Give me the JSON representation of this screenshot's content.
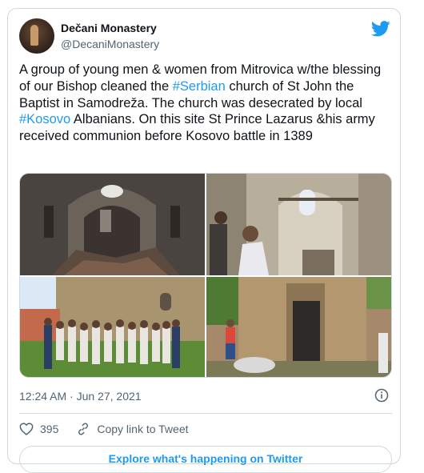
{
  "tweet": {
    "author_name": "Dečani Monastery",
    "author_handle": "@DecaniMonastery",
    "text_parts": [
      "A group of young men & women from Mitrovica w/the blessing of our Bishop cleaned the ",
      "#Serbian",
      " church of St John the Baptist in Samodreža. The church was desecrated by local ",
      "#Kosovo",
      " Albanians. On this site St Prince Lazarus &his army received communion before Kosovo battle in 1389"
    ],
    "timestamp": "12:24 AM · Jun 27, 2021",
    "like_count": "395",
    "copy_link_label": "Copy link to Tweet",
    "explore_label": "Explore what's happening on Twitter"
  },
  "colors": {
    "accent": "#1d9bf0",
    "secondary_text": "#536471",
    "border": "#cfd9de"
  },
  "icons": {
    "brand": "twitter-bird-icon",
    "info": "info-icon",
    "like": "heart-icon",
    "copy": "link-icon"
  }
}
